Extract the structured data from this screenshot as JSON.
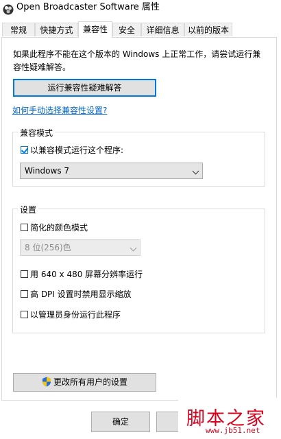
{
  "window": {
    "title": "Open Broadcaster Software 属性"
  },
  "tabs": [
    {
      "label": "常规"
    },
    {
      "label": "快捷方式"
    },
    {
      "label": "兼容性"
    },
    {
      "label": "安全"
    },
    {
      "label": "详细信息"
    },
    {
      "label": "以前的版本"
    }
  ],
  "active_tab": "兼容性",
  "intro_text": "如果此程序不能在这个版本的 Windows 上正常工作，请尝试运行兼容性疑难解答。",
  "troubleshoot_button": "运行兼容性疑难解答",
  "manual_link": "如何手动选择兼容性设置?",
  "compat_mode": {
    "group_title": "兼容模式",
    "checkbox_label": "以兼容模式运行这个程序:",
    "checked": true,
    "selected_os": "Windows 7"
  },
  "settings": {
    "group_title": "设置",
    "reduced_color": {
      "label": "简化的颜色模式",
      "checked": false
    },
    "color_depth": "8 位(256)色",
    "res_640": {
      "label": "用 640 x 480 屏幕分辨率运行",
      "checked": false
    },
    "high_dpi": {
      "label": "高 DPI 设置时禁用显示缩放",
      "checked": false
    },
    "run_as_admin": {
      "label": "以管理员身份运行此程序",
      "checked": false
    }
  },
  "change_all_users_button": "更改所有用户的设置",
  "ok_button": "确定",
  "watermark": {
    "text": "脚本之家",
    "url": "www.jb51.net"
  },
  "colors": {
    "accent": "#0078d7",
    "link": "#0066cc",
    "watermark": "#d9001b"
  }
}
